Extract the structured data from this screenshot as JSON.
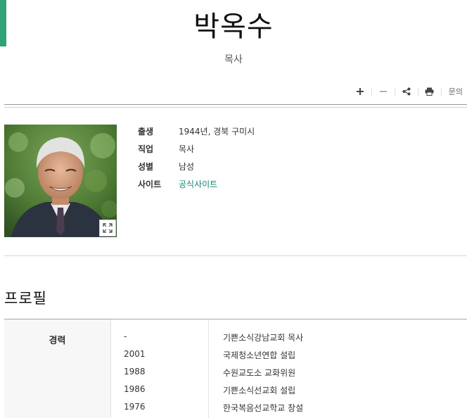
{
  "header": {
    "title": "박옥수",
    "subtitle": "목사"
  },
  "toolbar": {
    "icons": [
      "plus-icon",
      "minus-icon",
      "share-icon",
      "print-icon"
    ],
    "inquiry_label": "문의"
  },
  "profile_box": {
    "photo_alt_icon": "expand-icon",
    "fields": [
      {
        "key": "출생",
        "value": "1944년, 경북 구미시"
      },
      {
        "key": "직업",
        "value": "목사"
      },
      {
        "key": "성별",
        "value": "남성"
      },
      {
        "key": "사이트",
        "value": "공식사이트"
      }
    ]
  },
  "section": {
    "title": "프로필"
  },
  "career": {
    "label": "경력",
    "rows": [
      {
        "year": "-",
        "desc": "기쁜소식강남교회 목사"
      },
      {
        "year": "2001",
        "desc": "국제청소년연합 설립"
      },
      {
        "year": "1988",
        "desc": "수원교도소 교화위원"
      },
      {
        "year": "1986",
        "desc": "기쁜소식선교회 설립"
      },
      {
        "year": "1976",
        "desc": "한국복음선교학교 창설"
      }
    ]
  },
  "colors": {
    "accent": "#2fa374",
    "link": "#11866f"
  }
}
